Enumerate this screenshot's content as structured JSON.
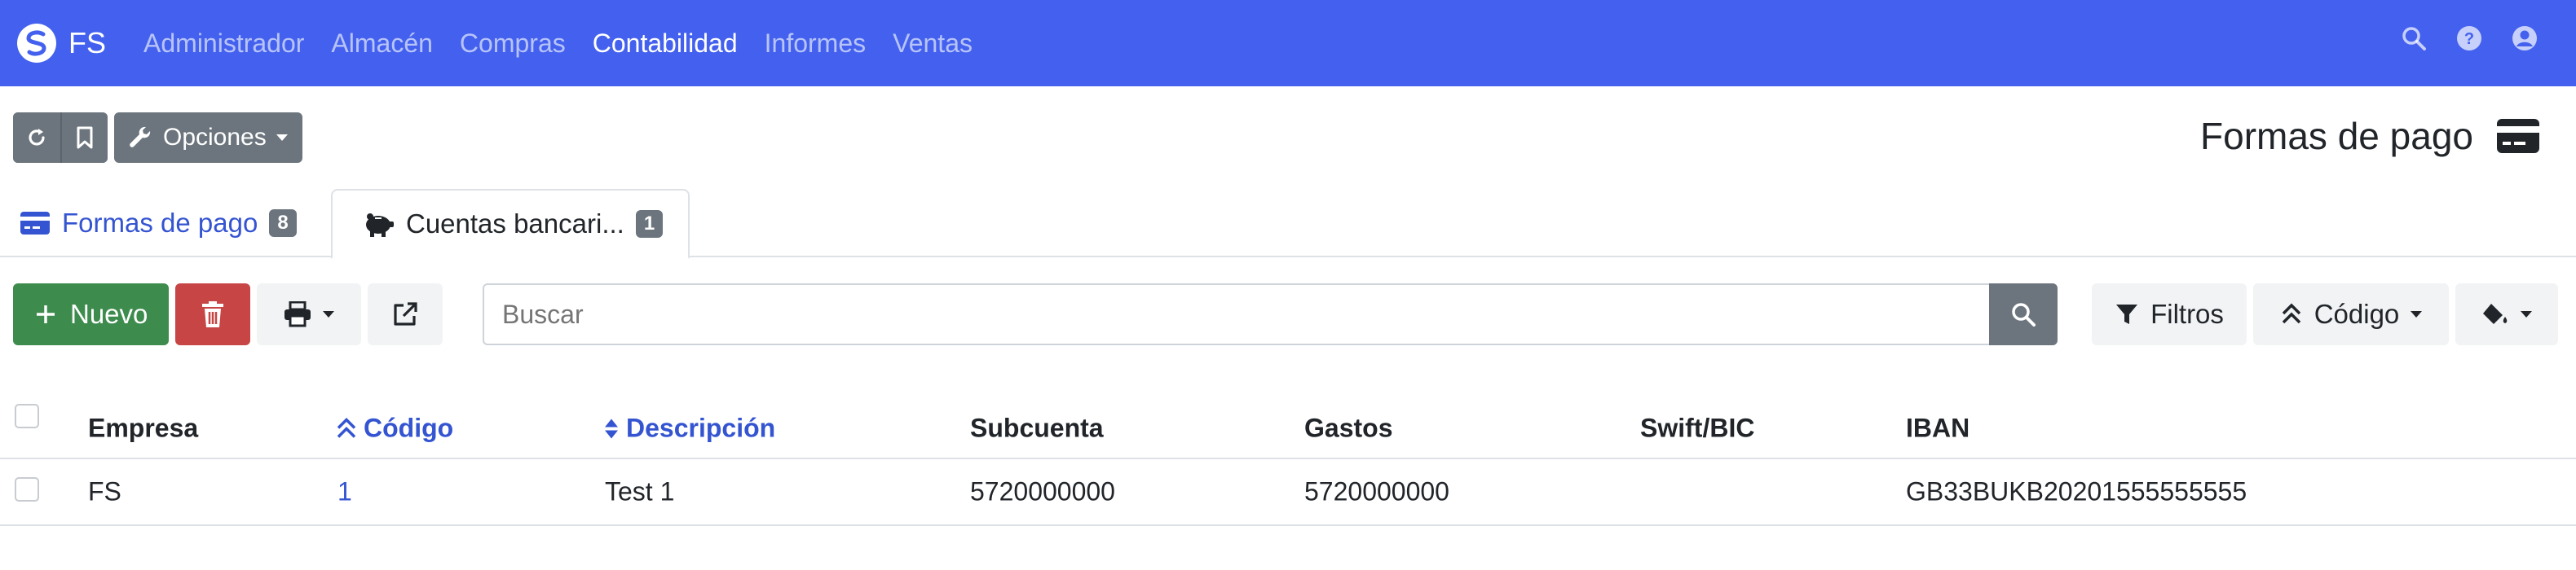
{
  "navbar": {
    "brand": "FS",
    "items": [
      {
        "label": "Administrador",
        "active": false
      },
      {
        "label": "Almacén",
        "active": false
      },
      {
        "label": "Compras",
        "active": false
      },
      {
        "label": "Contabilidad",
        "active": true
      },
      {
        "label": "Informes",
        "active": false
      },
      {
        "label": "Ventas",
        "active": false
      }
    ],
    "right_icons": [
      "search-icon",
      "help-icon",
      "user-icon"
    ]
  },
  "toolbar": {
    "options_label": "Opciones"
  },
  "page": {
    "title": "Formas de pago"
  },
  "tabs": [
    {
      "label": "Formas de pago",
      "count": "8",
      "active": false
    },
    {
      "label": "Cuentas bancari...",
      "count": "1",
      "active": true
    }
  ],
  "actions": {
    "new_label": "Nuevo",
    "search_placeholder": "Buscar",
    "filters_label": "Filtros",
    "order_label": "Código"
  },
  "table": {
    "columns": [
      "Empresa",
      "Código",
      "Descripción",
      "Subcuenta",
      "Gastos",
      "Swift/BIC",
      "IBAN"
    ],
    "rows": [
      {
        "empresa": "FS",
        "codigo": "1",
        "descripcion": "Test 1",
        "subcuenta": "5720000000",
        "gastos": "5720000000",
        "swift": "",
        "iban": "GB33BUKB20201555555555"
      }
    ]
  },
  "colors": {
    "navbar": "#4361ee",
    "primary_link": "#3454d1",
    "success": "#3d8b4d",
    "danger": "#c74545",
    "secondary": "#6c757d"
  }
}
